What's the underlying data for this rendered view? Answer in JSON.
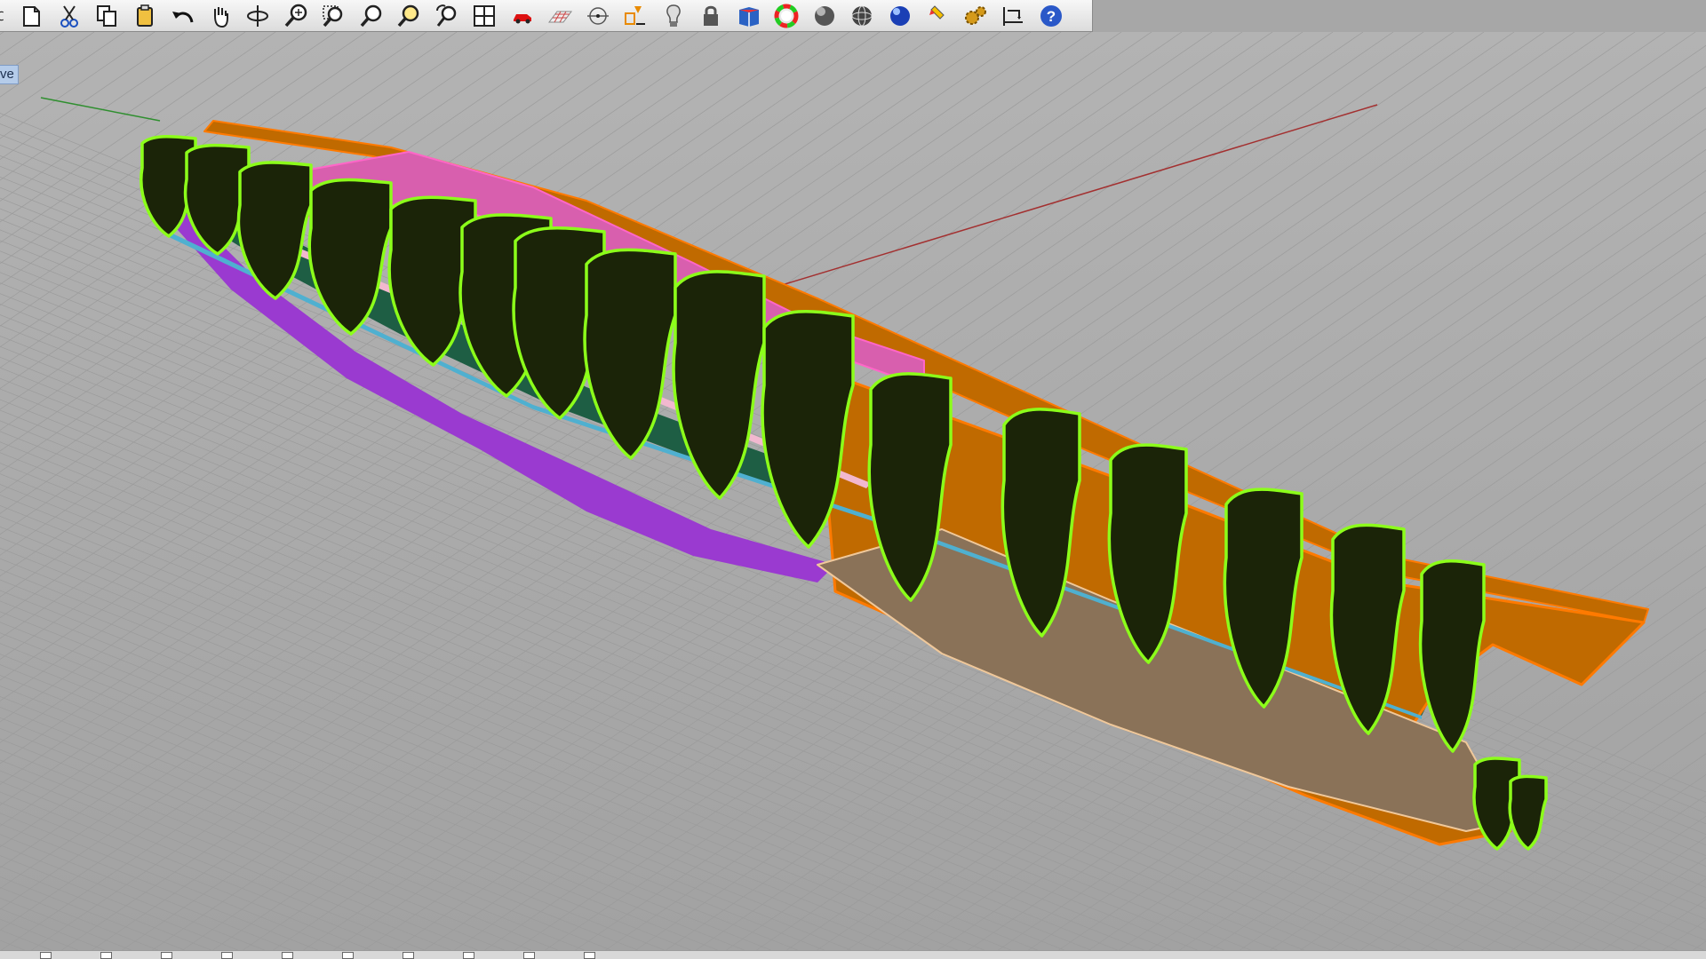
{
  "window": {
    "viewport_label": "ve"
  },
  "toolbar": {
    "buttons": [
      {
        "icon": "rotate-view-icon"
      },
      {
        "icon": "new-document-icon"
      },
      {
        "icon": "cut-icon"
      },
      {
        "icon": "copy-icon"
      },
      {
        "icon": "paste-icon"
      },
      {
        "icon": "undo-icon"
      },
      {
        "icon": "pan-hand-icon"
      },
      {
        "icon": "rotate-icon"
      },
      {
        "icon": "zoom-dynamic-icon"
      },
      {
        "icon": "zoom-window-icon"
      },
      {
        "icon": "zoom-extents-icon"
      },
      {
        "icon": "zoom-selected-icon"
      },
      {
        "icon": "undo-view-icon"
      },
      {
        "icon": "four-viewports-icon"
      },
      {
        "icon": "car-object-icon"
      },
      {
        "icon": "grid-plane-icon"
      },
      {
        "icon": "point-snap-icon"
      },
      {
        "icon": "select-objects-icon"
      },
      {
        "icon": "light-bulb-icon"
      },
      {
        "icon": "lock-icon"
      },
      {
        "icon": "layer-book-icon"
      },
      {
        "icon": "color-wheel-icon"
      },
      {
        "icon": "shaded-sphere-icon"
      },
      {
        "icon": "wireframe-sphere-icon"
      },
      {
        "icon": "render-sphere-icon"
      },
      {
        "icon": "highlighter-icon"
      },
      {
        "icon": "settings-gears-icon"
      },
      {
        "icon": "dimension-icon"
      },
      {
        "icon": "help-icon"
      }
    ]
  },
  "colors": {
    "background": "#a7a7a7",
    "grid_line": "#9b9b9b",
    "x_axis": "#a33",
    "y_axis": "#3a3",
    "frame_outline": "#8cff1a",
    "frame_fill": "#1b2408",
    "side_girder": "#c06a00",
    "pink_panel": "#d85fae",
    "deck_green": "#1e5e44",
    "keel_purple": "#9a3ad0",
    "beige_panel": "#8a7258"
  },
  "statusbar": {
    "snap_count": 10
  }
}
